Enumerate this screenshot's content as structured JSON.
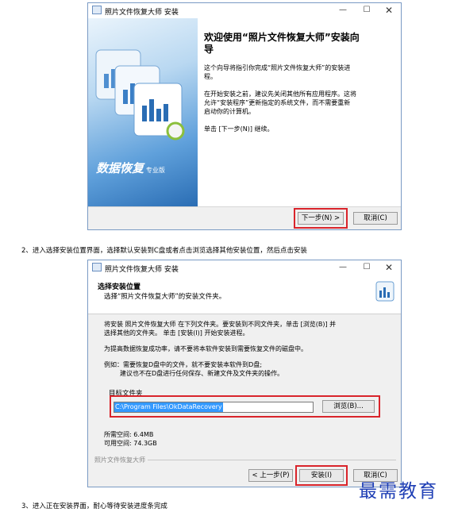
{
  "win1": {
    "title": "照片文件恢复大师 安装",
    "heading_l1": "欢迎使用“照片文件恢复大师”安装向",
    "heading_l2": "导",
    "p1_l1": "这个向导将指引你完成“照片文件恢复大师”的安装进",
    "p1_l2": "程。",
    "p2_l1": "在开始安装之前，建议先关闭其他所有应用程序。这将",
    "p2_l2": "允许“安装程序”更新指定的系统文件，而不需要重新",
    "p2_l3": "启动你的计算机。",
    "p3": "单击 [下一步(N)] 继续。",
    "banner_text": "数据恢复",
    "banner_sub": "专业版",
    "next_btn": "下一步(N) >",
    "cancel_btn": "取消(C)"
  },
  "caption2": "2、进入选择安装位置界面，选择默认安装到C盘或者点击浏览选择其他安装位置，然后点击安装",
  "win2": {
    "title": "照片文件恢复大师 安装",
    "header_title": "选择安装位置",
    "header_sub": "选择“照片文件恢复大师”的安装文件夹。",
    "l1": "将安装 照片文件恢复大师 在下列文件夹。要安装到不同文件夹，单击 [浏览(B)] 并",
    "l2": "选择其他的文件夹。 单击 [安装(I)] 开始安装进程。",
    "l3": "为提高数据恢复成功率，请不要将本软件安装到需要恢复文件的磁盘中。",
    "l4": "例如：需要恢复D盘中的文件，就不要安装本软件到D盘;",
    "l5": "建议也不在D盘进行任何保存、新建文件及文件夹的操作。",
    "target_label": "目标文件夹",
    "path": "C:\\Program Files\\OkDataRecovery",
    "browse_btn": "浏览(B)...",
    "space_req": "所需空间: 6.4MB",
    "space_avail": "可用空间: 74.3GB",
    "brand": "照片文件恢复大师",
    "back_btn": "< 上一步(P)",
    "install_btn": "安装(I)",
    "cancel_btn": "取消(C)"
  },
  "watermark": "最需教育",
  "caption3": "3、进入正在安装界面，耐心等待安装进度条完成",
  "colors": {
    "accent_red": "#d9242b",
    "selection_blue": "#3399ff",
    "banner_blue": "#2a6db4"
  }
}
